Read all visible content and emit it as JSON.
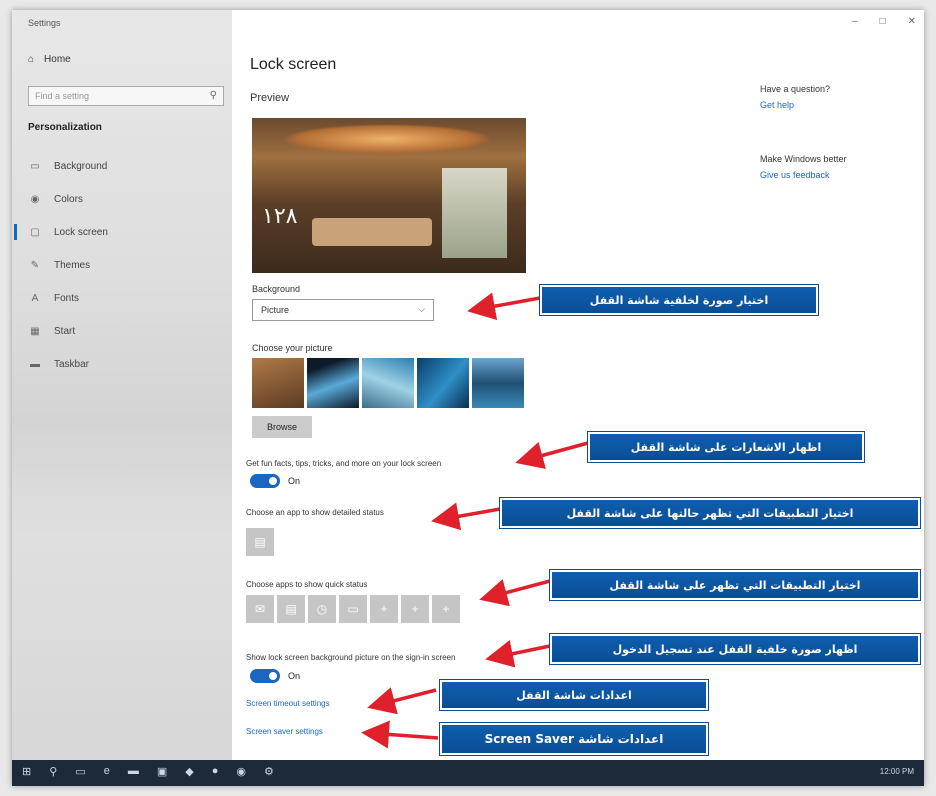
{
  "window": {
    "app_title": "Settings",
    "minimize": "–",
    "maximize": "□",
    "close": "✕"
  },
  "sidebar": {
    "home": "Home",
    "search_placeholder": "Find a setting",
    "section": "Personalization",
    "items": [
      {
        "label": "Background",
        "icon": "image-icon",
        "glyph": "▭"
      },
      {
        "label": "Colors",
        "icon": "palette-icon",
        "glyph": "◉"
      },
      {
        "label": "Lock screen",
        "icon": "lock-screen-icon",
        "glyph": "▢"
      },
      {
        "label": "Themes",
        "icon": "brush-icon",
        "glyph": "✎"
      },
      {
        "label": "Fonts",
        "icon": "font-icon",
        "glyph": "A"
      },
      {
        "label": "Start",
        "icon": "start-icon",
        "glyph": "▦"
      },
      {
        "label": "Taskbar",
        "icon": "taskbar-icon",
        "glyph": "▬"
      }
    ]
  },
  "main": {
    "title": "Lock screen",
    "preview_label": "Preview",
    "clock_text": "١٢٨",
    "background_label": "Background",
    "background_value": "Picture",
    "choose_picture_label": "Choose your picture",
    "browse_label": "Browse",
    "fun_facts_label": "Get fun facts, tips, tricks, and more on your lock screen",
    "fun_facts_state": "On",
    "detailed_status_label": "Choose an app to show detailed status",
    "quick_status_label": "Choose apps to show quick status",
    "show_bg_label": "Show lock screen background picture on the sign-in screen",
    "show_bg_state": "On",
    "screen_timeout_link": "Screen timeout settings",
    "screen_saver_link": "Screen saver settings"
  },
  "right_panel": {
    "question": "Have a question?",
    "get_help": "Get help",
    "better": "Make Windows better",
    "feedback": "Give us feedback"
  },
  "callouts": {
    "c1": "اختيار صورة لخلفية شاشة القفل",
    "c2": "اظهار الاشعارات على شاشة القفل",
    "c3": "اختيار التطبيقات التي تظهر حالتها على شاشة القفل",
    "c4": "اختيار التطبيقات التي تظهر  على شاشة القفل",
    "c5": "اظهار صورة خلفية القفل عند تسجيل الدخول",
    "c6": "اعدادات شاشة القفل",
    "c7": "اعدادات شاشة Screen Saver"
  },
  "taskbar": {
    "time": "12:00 PM"
  },
  "colors": {
    "accent": "#1a66c1",
    "callout": "#0f5fb0",
    "arrow": "#e0202a"
  }
}
